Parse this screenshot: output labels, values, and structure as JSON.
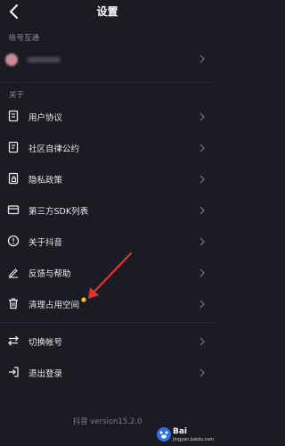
{
  "header": {
    "title": "设置",
    "back_icon": "back-arrow-icon"
  },
  "sections": {
    "account": "帐号互通",
    "about": "关于"
  },
  "menu": [
    {
      "id": "user-agreement",
      "label": "用户协议",
      "icon": "document-icon"
    },
    {
      "id": "community-rules",
      "label": "社区自律公约",
      "icon": "document-icon"
    },
    {
      "id": "privacy-policy",
      "label": "隐私政策",
      "icon": "privacy-document-icon"
    },
    {
      "id": "third-party-sdk",
      "label": "第三方SDK列表",
      "icon": "card-icon"
    },
    {
      "id": "about-douyin",
      "label": "关于抖音",
      "icon": "info-icon"
    },
    {
      "id": "feedback",
      "label": "反馈与帮助",
      "icon": "edit-icon"
    },
    {
      "id": "clear-storage",
      "label": "清理占用空间",
      "icon": "trash-icon"
    },
    {
      "id": "switch-account",
      "label": "切换帐号",
      "icon": "switch-icon"
    },
    {
      "id": "logout",
      "label": "退出登录",
      "icon": "logout-icon"
    }
  ],
  "footer": {
    "version": "抖音 version15.2.0"
  },
  "watermark": {
    "text": "Bai",
    "sub": "jingyan.baidu.com"
  },
  "colors": {
    "background": "#1a1b23",
    "annotation_arrow": "#e03434",
    "notification_dot": "#f5c518"
  }
}
